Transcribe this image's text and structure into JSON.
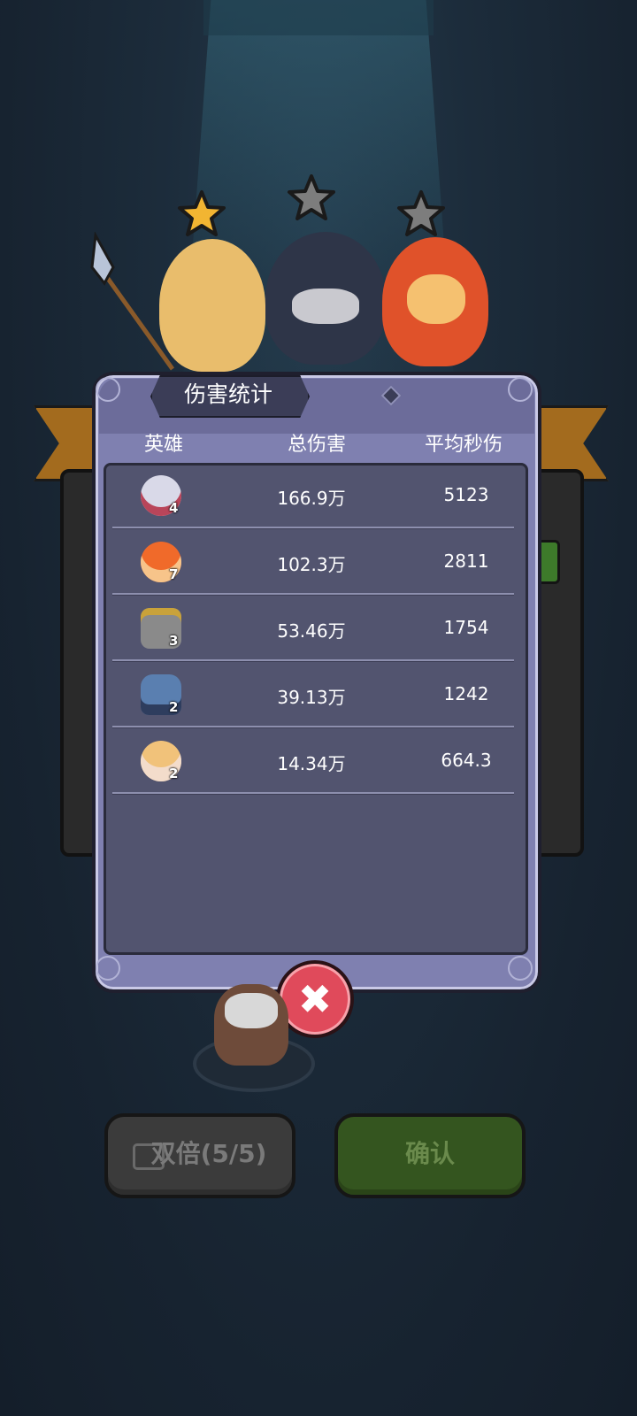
{
  "dialog": {
    "title": "伤害统计",
    "columns": [
      "英雄",
      "总伤害",
      "平均秒伤"
    ],
    "rows": [
      {
        "level": "4",
        "total_damage": "166.9万",
        "avg_dps": "5123",
        "avatar_color": "#d9d9e8"
      },
      {
        "level": "7",
        "total_damage": "102.3万",
        "avg_dps": "2811",
        "avatar_color": "#f06a2a"
      },
      {
        "level": "3",
        "total_damage": "53.46万",
        "avg_dps": "1754",
        "avatar_color": "#8a8a8a"
      },
      {
        "level": "2",
        "total_damage": "39.13万",
        "avg_dps": "1242",
        "avatar_color": "#5a7fb0"
      },
      {
        "level": "2",
        "total_damage": "14.34万",
        "avg_dps": "664.3",
        "avatar_color": "#f1c27a"
      }
    ]
  },
  "stars": {
    "filled": 1,
    "total": 3
  },
  "buttons": {
    "double_label": "双倍(5/5)",
    "confirm_label": "确认",
    "close_icon": "close-x"
  },
  "colors": {
    "dialog_bg": "#7f80b0",
    "table_bg": "#52546f",
    "close_red": "#e04a5b",
    "confirm_green": "#34551f",
    "star_gold": "#f2b532"
  }
}
